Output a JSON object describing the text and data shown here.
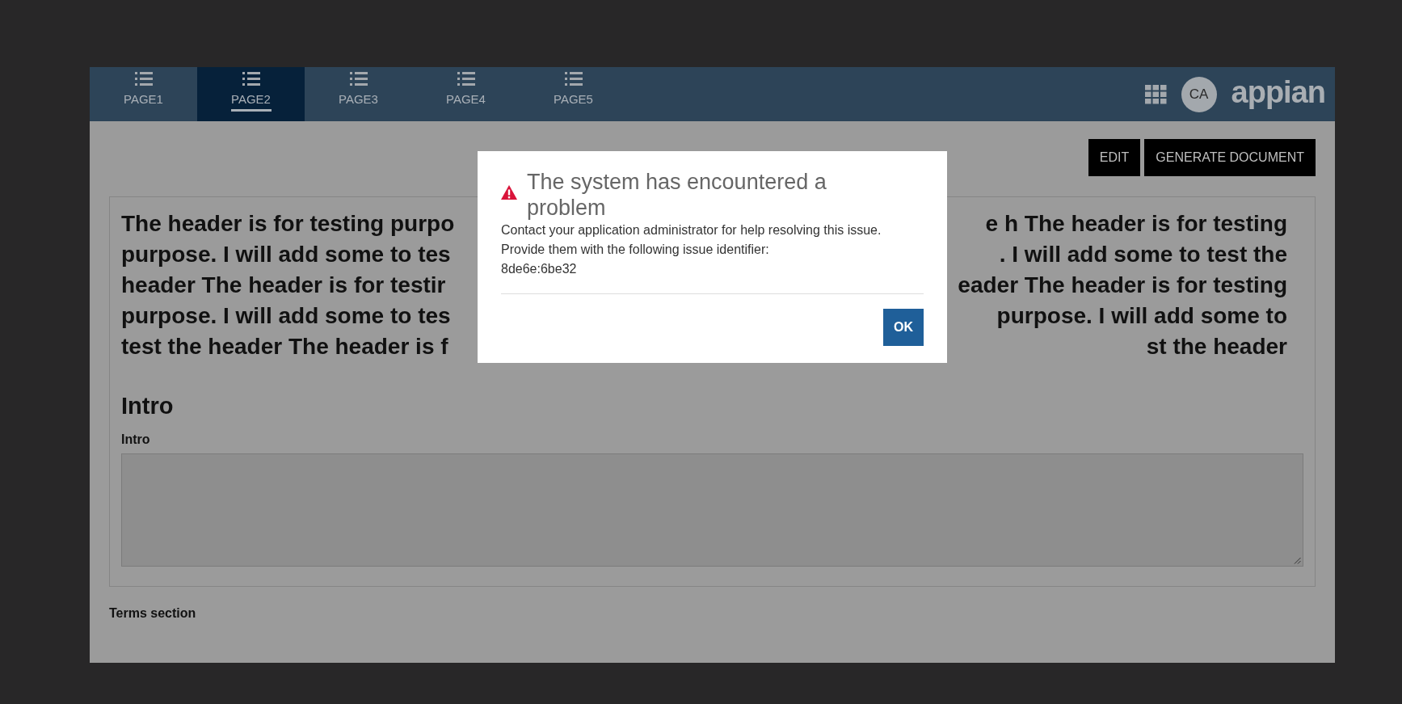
{
  "tabs": [
    {
      "label": "PAGE1",
      "selected": false
    },
    {
      "label": "PAGE2",
      "selected": true
    },
    {
      "label": "PAGE3",
      "selected": false
    },
    {
      "label": "PAGE4",
      "selected": false
    },
    {
      "label": "PAGE5",
      "selected": false
    }
  ],
  "user": {
    "initials": "CA"
  },
  "logo": "appian",
  "actions": [
    "EDIT",
    "GENERATE DOCUMENT"
  ],
  "header_lines": [
    {
      "left": "The header is for testing purpo",
      "right": "e h The header is for testing"
    },
    {
      "left": "purpose. I will add some to tes",
      "right": ". I will add some to test the"
    },
    {
      "left": "header The header is for testir",
      "right": "eader The header is for testing"
    },
    {
      "left": "purpose. I will add some to tes",
      "right": "purpose. I will add some to"
    },
    {
      "left": "test the header The header is f",
      "right": "st the header"
    }
  ],
  "section": {
    "title": "Intro",
    "field_label": "Intro"
  },
  "terms_label": "Terms section",
  "dialog": {
    "title": "The system has encountered a problem",
    "message": "Contact your application administrator for help resolving this issue. Provide them with the following issue identifier:",
    "identifier": "8de6e:6be32",
    "button": "OK"
  }
}
